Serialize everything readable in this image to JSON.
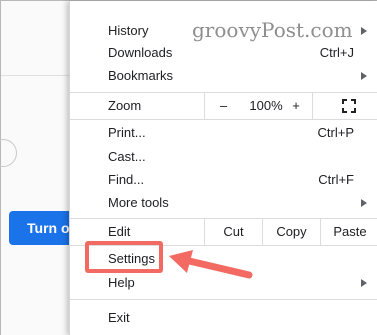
{
  "background": {
    "turn_on_label": "Turn on"
  },
  "watermark": "groovyPost.com",
  "menu": {
    "history": "History",
    "downloads": "Downloads",
    "downloads_shortcut": "Ctrl+J",
    "bookmarks": "Bookmarks",
    "zoom": {
      "label": "Zoom",
      "minus": "–",
      "level": "100%",
      "plus": "+"
    },
    "print": "Print...",
    "print_shortcut": "Ctrl+P",
    "cast": "Cast...",
    "find": "Find...",
    "find_shortcut": "Ctrl+F",
    "more_tools": "More tools",
    "edit": {
      "label": "Edit",
      "cut": "Cut",
      "copy": "Copy",
      "paste": "Paste"
    },
    "settings": "Settings",
    "help": "Help",
    "exit": "Exit"
  },
  "colors": {
    "accent_blue": "#1a73e8",
    "highlight_red": "#f26a61"
  },
  "icons": {
    "submenu": "chevron-right-icon",
    "fullscreen": "fullscreen-icon",
    "annotation": "red-arrow-icon"
  }
}
